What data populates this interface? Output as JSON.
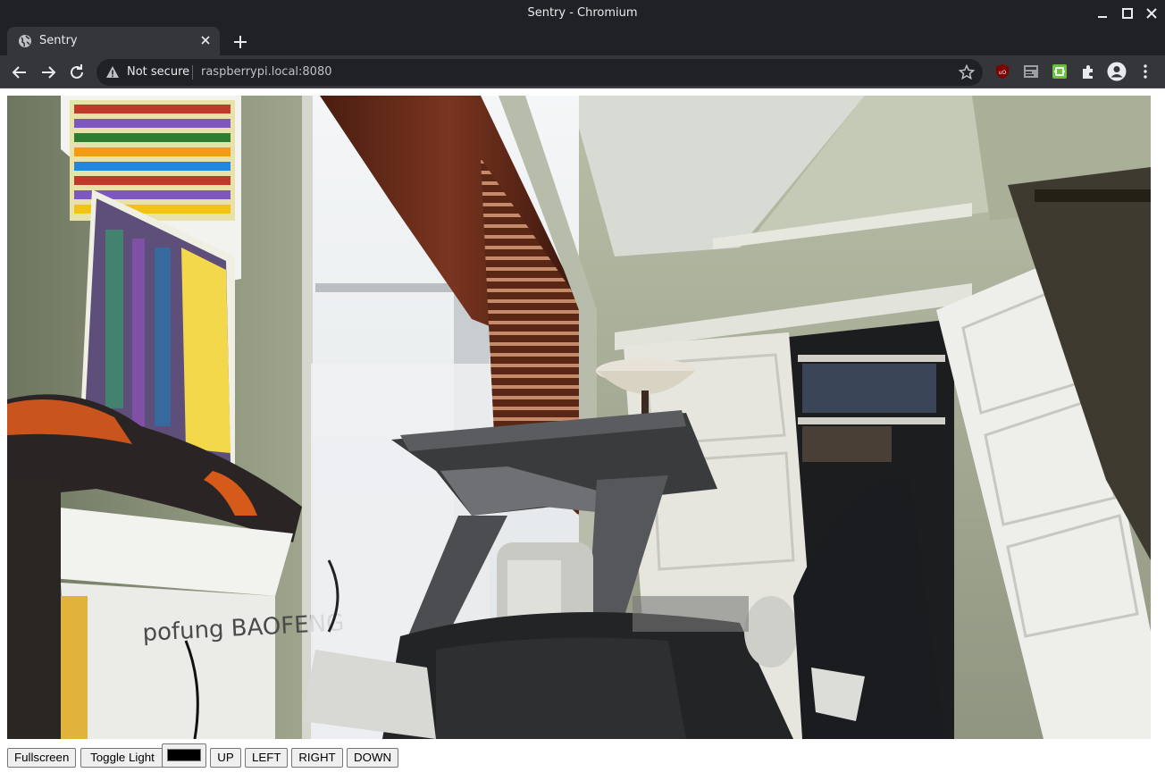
{
  "window": {
    "title": "Sentry - Chromium"
  },
  "tab": {
    "title": "Sentry"
  },
  "toolbar": {
    "security_label": "Not secure",
    "url": "raspberrypi.local:8080"
  },
  "colors": {
    "chrome_dark": "#202124",
    "chrome_toolbar": "#35363a",
    "light_color_value": "#000000"
  },
  "controls": {
    "fullscreen": "Fullscreen",
    "toggle_light": "Toggle Light",
    "up": "UP",
    "left": "LEFT",
    "right": "RIGHT",
    "down": "DOWN"
  }
}
